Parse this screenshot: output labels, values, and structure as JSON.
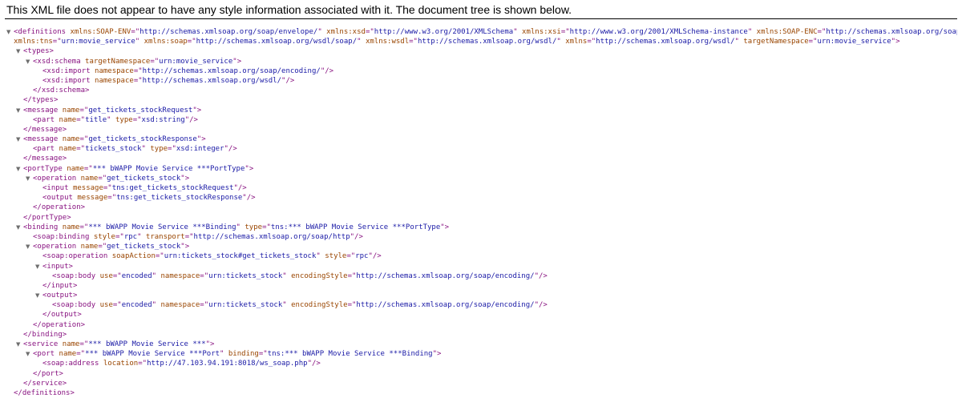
{
  "header": {
    "message": "This XML file does not appear to have any style information associated with it. The document tree is shown below."
  },
  "icons": {
    "expanded": "triangle-down-icon"
  },
  "colors": {
    "tag": "#881280",
    "attribute_name": "#994500",
    "attribute_value": "#1a1aa6"
  },
  "lines": [
    {
      "indent": 0,
      "toggle": true,
      "tag": "definitions",
      "attrs": [
        [
          "xmlns:SOAP-ENV",
          "http://schemas.xmlsoap.org/soap/envelope/"
        ],
        [
          "xmlns:xsd",
          "http://www.w3.org/2001/XMLSchema"
        ],
        [
          "xmlns:xsi",
          "http://www.w3.org/2001/XMLSchema-instance"
        ],
        [
          "xmlns:SOAP-ENC",
          "http://schemas.xmlsoap.org/soap/encoding/"
        ]
      ],
      "end": ""
    },
    {
      "indent": 0,
      "cont": true,
      "attrs": [
        [
          "xmlns:tns",
          "urn:movie_service"
        ],
        [
          "xmlns:soap",
          "http://schemas.xmlsoap.org/wsdl/soap/"
        ],
        [
          "xmlns:wsdl",
          "http://schemas.xmlsoap.org/wsdl/"
        ],
        [
          "xmlns",
          "http://schemas.xmlsoap.org/wsdl/"
        ],
        [
          "targetNamespace",
          "urn:movie_service"
        ]
      ],
      "end": ">"
    },
    {
      "indent": 1,
      "toggle": true,
      "tag": "types",
      "attrs": [],
      "end": ">"
    },
    {
      "indent": 2,
      "toggle": true,
      "tag": "xsd:schema",
      "attrs": [
        [
          "targetNamespace",
          "urn:movie_service"
        ]
      ],
      "end": ">"
    },
    {
      "indent": 3,
      "tag": "xsd:import",
      "attrs": [
        [
          "namespace",
          "http://schemas.xmlsoap.org/soap/encoding/"
        ]
      ],
      "end": "/>"
    },
    {
      "indent": 3,
      "tag": "xsd:import",
      "attrs": [
        [
          "namespace",
          "http://schemas.xmlsoap.org/wsdl/"
        ]
      ],
      "end": "/>"
    },
    {
      "indent": 2,
      "close": "xsd:schema"
    },
    {
      "indent": 1,
      "close": "types"
    },
    {
      "indent": 1,
      "toggle": true,
      "tag": "message",
      "attrs": [
        [
          "name",
          "get_tickets_stockRequest"
        ]
      ],
      "end": ">"
    },
    {
      "indent": 2,
      "tag": "part",
      "attrs": [
        [
          "name",
          "title"
        ],
        [
          "type",
          "xsd:string"
        ]
      ],
      "end": "/>"
    },
    {
      "indent": 1,
      "close": "message"
    },
    {
      "indent": 1,
      "toggle": true,
      "tag": "message",
      "attrs": [
        [
          "name",
          "get_tickets_stockResponse"
        ]
      ],
      "end": ">"
    },
    {
      "indent": 2,
      "tag": "part",
      "attrs": [
        [
          "name",
          "tickets_stock"
        ],
        [
          "type",
          "xsd:integer"
        ]
      ],
      "end": "/>"
    },
    {
      "indent": 1,
      "close": "message"
    },
    {
      "indent": 1,
      "toggle": true,
      "tag": "portType",
      "attrs": [
        [
          "name",
          "*** bWAPP Movie Service ***PortType"
        ]
      ],
      "end": ">"
    },
    {
      "indent": 2,
      "toggle": true,
      "tag": "operation",
      "attrs": [
        [
          "name",
          "get_tickets_stock"
        ]
      ],
      "end": ">"
    },
    {
      "indent": 3,
      "tag": "input",
      "attrs": [
        [
          "message",
          "tns:get_tickets_stockRequest"
        ]
      ],
      "end": "/>"
    },
    {
      "indent": 3,
      "tag": "output",
      "attrs": [
        [
          "message",
          "tns:get_tickets_stockResponse"
        ]
      ],
      "end": "/>"
    },
    {
      "indent": 2,
      "close": "operation"
    },
    {
      "indent": 1,
      "close": "portType"
    },
    {
      "indent": 1,
      "toggle": true,
      "tag": "binding",
      "attrs": [
        [
          "name",
          "*** bWAPP Movie Service ***Binding"
        ],
        [
          "type",
          "tns:*** bWAPP Movie Service ***PortType"
        ]
      ],
      "end": ">"
    },
    {
      "indent": 2,
      "tag": "soap:binding",
      "attrs": [
        [
          "style",
          "rpc"
        ],
        [
          "transport",
          "http://schemas.xmlsoap.org/soap/http"
        ]
      ],
      "end": "/>"
    },
    {
      "indent": 2,
      "toggle": true,
      "tag": "operation",
      "attrs": [
        [
          "name",
          "get_tickets_stock"
        ]
      ],
      "end": ">"
    },
    {
      "indent": 3,
      "tag": "soap:operation",
      "attrs": [
        [
          "soapAction",
          "urn:tickets_stock#get_tickets_stock"
        ],
        [
          "style",
          "rpc"
        ]
      ],
      "end": "/>"
    },
    {
      "indent": 3,
      "toggle": true,
      "tag": "input",
      "attrs": [],
      "end": ">"
    },
    {
      "indent": 4,
      "tag": "soap:body",
      "attrs": [
        [
          "use",
          "encoded"
        ],
        [
          "namespace",
          "urn:tickets_stock"
        ],
        [
          "encodingStyle",
          "http://schemas.xmlsoap.org/soap/encoding/"
        ]
      ],
      "end": "/>"
    },
    {
      "indent": 3,
      "close": "input"
    },
    {
      "indent": 3,
      "toggle": true,
      "tag": "output",
      "attrs": [],
      "end": ">"
    },
    {
      "indent": 4,
      "tag": "soap:body",
      "attrs": [
        [
          "use",
          "encoded"
        ],
        [
          "namespace",
          "urn:tickets_stock"
        ],
        [
          "encodingStyle",
          "http://schemas.xmlsoap.org/soap/encoding/"
        ]
      ],
      "end": "/>"
    },
    {
      "indent": 3,
      "close": "output"
    },
    {
      "indent": 2,
      "close": "operation"
    },
    {
      "indent": 1,
      "close": "binding"
    },
    {
      "indent": 1,
      "toggle": true,
      "tag": "service",
      "attrs": [
        [
          "name",
          "*** bWAPP Movie Service ***"
        ]
      ],
      "end": ">"
    },
    {
      "indent": 2,
      "toggle": true,
      "tag": "port",
      "attrs": [
        [
          "name",
          "*** bWAPP Movie Service ***Port"
        ],
        [
          "binding",
          "tns:*** bWAPP Movie Service ***Binding"
        ]
      ],
      "end": ">"
    },
    {
      "indent": 3,
      "tag": "soap:address",
      "attrs": [
        [
          "location",
          "http://47.103.94.191:8018/ws_soap.php"
        ]
      ],
      "end": "/>"
    },
    {
      "indent": 2,
      "close": "port"
    },
    {
      "indent": 1,
      "close": "service"
    },
    {
      "indent": 0,
      "close": "definitions"
    }
  ]
}
